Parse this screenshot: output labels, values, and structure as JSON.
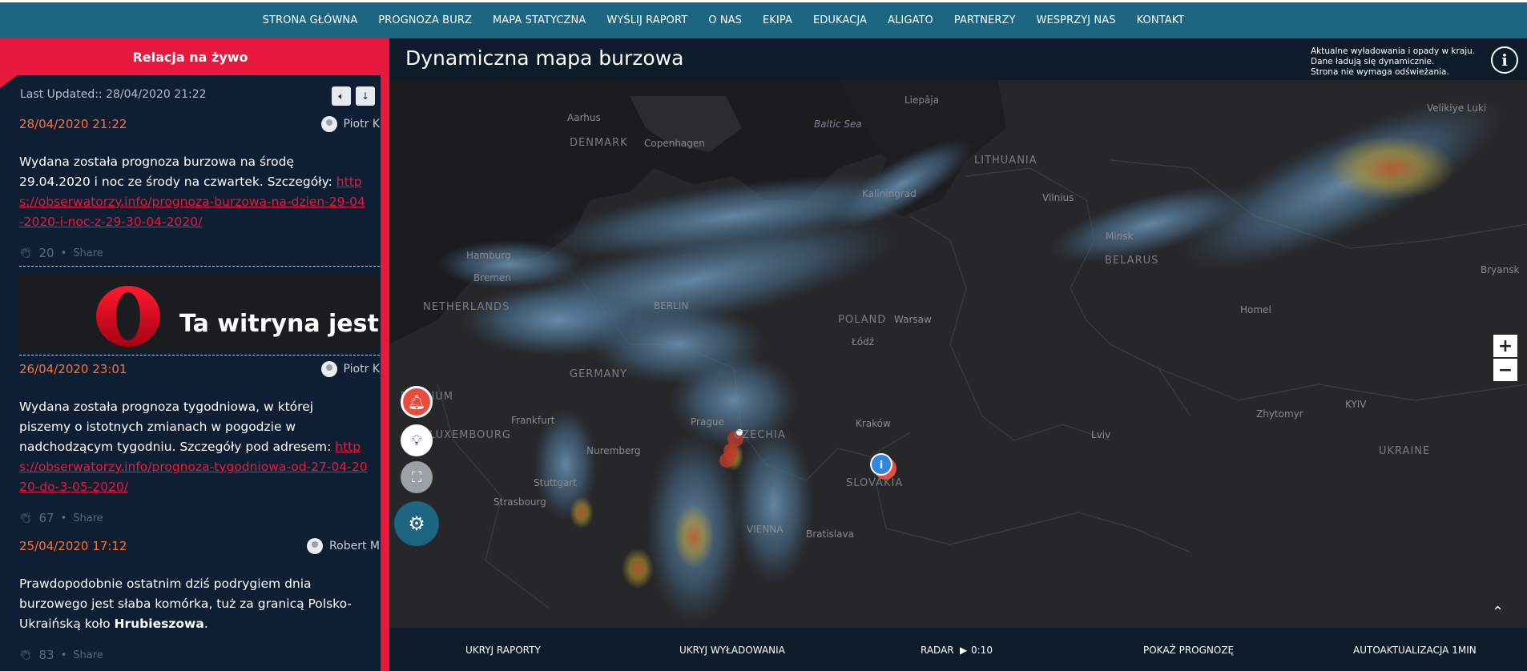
{
  "nav": {
    "items": [
      "STRONA GŁÓWNA",
      "PROGNOZA BURZ",
      "MAPA STATYCZNA",
      "WYŚLIJ RAPORT",
      "O NAS",
      "EKIPA",
      "EDUKACJA",
      "ALIGATO",
      "PARTNERZY",
      "WESPRZYJ NAS",
      "KONTAKT"
    ]
  },
  "live": {
    "title": "Relacja na żywo",
    "last_updated": "Last Updated:: 28/04/2020 21:22",
    "sound_icon": "speaker-icon",
    "scroll_icon": "arrow-down-icon"
  },
  "posts": [
    {
      "date": "28/04/2020 21:22",
      "author": "Piotr K",
      "text": "Wydana została prognoza burzowa na środę 29.04.2020 i noc ze środy na czwartek. Szczegóły:",
      "link": "https://obserwatorzy.info/prognoza-burzowa-na-dzien-29-04-2020-i-noc-z-29-30-04-2020/",
      "count": "20",
      "share": "Share"
    },
    {
      "date": "26/04/2020 23:01",
      "author": "Piotr K",
      "text": "Wydana została prognoza tygodniowa, w której piszemy o istotnych zmianach w pogodzie w nadchodzącym tygodniu. Szczegóły pod adresem:",
      "link": "https://obserwatorzy.info/prognoza-tygodniowa-od-27-04-2020-do-3-05-2020/",
      "count": "67",
      "share": "Share"
    },
    {
      "date": "25/04/2020 17:12",
      "author": "Robert M",
      "text": "Prawdopodobnie ostatnim dziś podrygiem dnia burzowego jest słaba komórka, tuż za granicą Polsko-Ukraińską koło",
      "bold": "Hrubieszowa",
      "tail": ".",
      "count": "83",
      "share": "Share"
    }
  ],
  "banner": {
    "text": "Ta witryna jest ni"
  },
  "map": {
    "title": "Dynamiczna mapa burzowa",
    "note_lines": [
      "Aktualne wyładowania i opady w kraju.",
      "Dane ładują się dynamicznie.",
      "Strona nie wymaga odświeżania."
    ],
    "zoom_in": "+",
    "zoom_out": "−",
    "labels": [
      {
        "t": "Liepāja",
        "k": "city"
      },
      {
        "t": "Velikiye Luki",
        "k": "city"
      },
      {
        "t": "Aarhus",
        "k": "city"
      },
      {
        "t": "DENMARK",
        "k": "country"
      },
      {
        "t": "Copenhagen",
        "k": "city"
      },
      {
        "t": "Baltic Sea",
        "k": "sea"
      },
      {
        "t": "LITHUANIA",
        "k": "country"
      },
      {
        "t": "Vilnius",
        "k": "city"
      },
      {
        "t": "Kaliningrad",
        "k": "city"
      },
      {
        "t": "Hamburg",
        "k": "city"
      },
      {
        "t": "Bremen",
        "k": "city"
      },
      {
        "t": "BELARUS",
        "k": "country"
      },
      {
        "t": "Minsk",
        "k": "city"
      },
      {
        "t": "Bryansk",
        "k": "city"
      },
      {
        "t": "NETHERLANDS",
        "k": "country"
      },
      {
        "t": "BERLIN",
        "k": "city"
      },
      {
        "t": "POLAND",
        "k": "country"
      },
      {
        "t": "Warsaw",
        "k": "city"
      },
      {
        "t": "Homel",
        "k": "city"
      },
      {
        "t": "Łódź",
        "k": "city"
      },
      {
        "t": "GERMANY",
        "k": "country"
      },
      {
        "t": "BELGIUM",
        "k": "country"
      },
      {
        "t": "Frankfurt",
        "k": "city"
      },
      {
        "t": "Prague",
        "k": "city"
      },
      {
        "t": "CZECHIA",
        "k": "country"
      },
      {
        "t": "Kraków",
        "k": "city"
      },
      {
        "t": "Zhytomyr",
        "k": "city"
      },
      {
        "t": "KYIV",
        "k": "city"
      },
      {
        "t": "LUXEMBOURG",
        "k": "country"
      },
      {
        "t": "Nuremberg",
        "k": "city"
      },
      {
        "t": "Lviv",
        "k": "city"
      },
      {
        "t": "UKRAINE",
        "k": "country"
      },
      {
        "t": "Stuttgart",
        "k": "city"
      },
      {
        "t": "Strasbourg",
        "k": "city"
      },
      {
        "t": "SLOVAKIA",
        "k": "country"
      },
      {
        "t": "VIENNA",
        "k": "city"
      },
      {
        "t": "Bratislava",
        "k": "city"
      }
    ]
  },
  "footer": {
    "items": [
      "UKRYJ RAPORTY",
      "UKRYJ WYŁADOWANIA",
      "RADAR",
      "0:10",
      "POKAŻ PROGNOZĘ",
      "AUTOAKTUALIZACJA 1MIN"
    ]
  },
  "colors": {
    "accent_red": "#e8193c",
    "nav_blue": "#1c6583",
    "panel_bg": "#0e1f33",
    "date_orange": "#ff7037"
  }
}
